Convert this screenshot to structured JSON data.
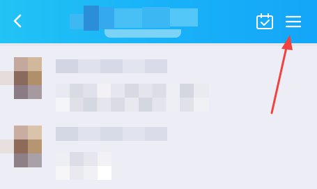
{
  "header": {
    "bg_colors": [
      "#22c3f5",
      "#14a6f8"
    ],
    "back_icon": "chevron-left-icon",
    "calendar_icon": "calendar-check-icon",
    "menu_icon": "hamburger-menu-icon",
    "title_state": "pixelated"
  },
  "chat_list": {
    "items": [
      {
        "state": "pixelated"
      },
      {
        "state": "pixelated"
      }
    ]
  },
  "annotation": {
    "arrow_color": "#f0423f",
    "points_to": "menu-button"
  },
  "colors": {
    "background": "#ecedf5",
    "icon": "#ffffff"
  }
}
